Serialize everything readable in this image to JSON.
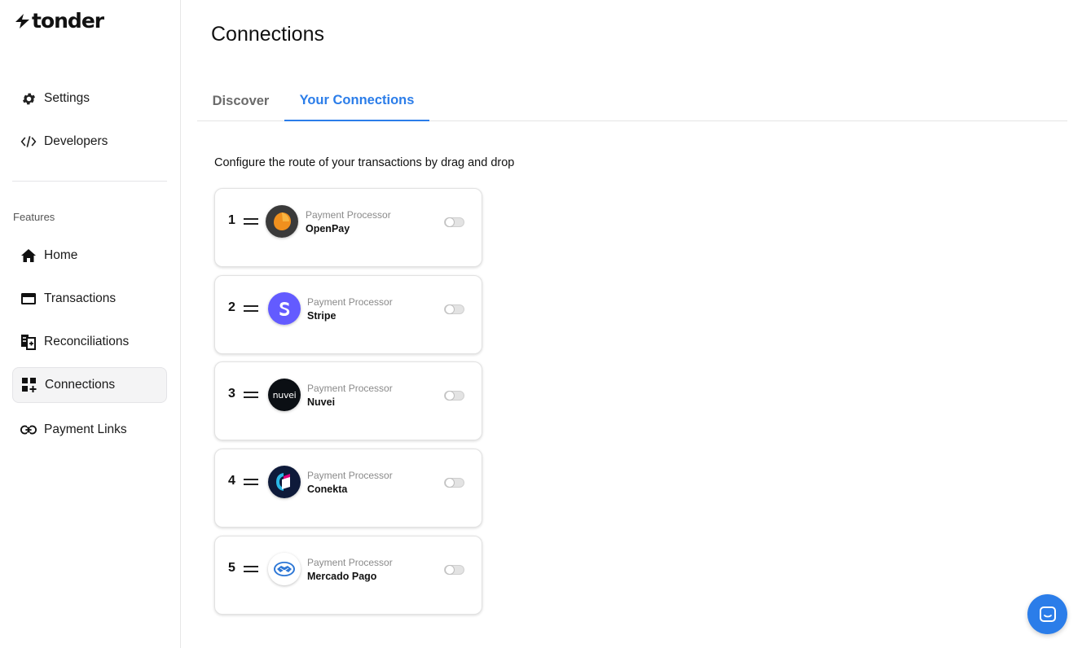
{
  "app": {
    "name": "tonder"
  },
  "sidebar": {
    "top_items": [
      {
        "label": "Settings",
        "icon": "gear-icon"
      },
      {
        "label": "Developers",
        "icon": "code-icon"
      }
    ],
    "section_label": "Features",
    "feature_items": [
      {
        "label": "Home",
        "icon": "home-icon"
      },
      {
        "label": "Transactions",
        "icon": "card-icon"
      },
      {
        "label": "Reconciliations",
        "icon": "reconcile-icon"
      },
      {
        "label": "Connections",
        "icon": "widgets-icon",
        "active": true
      },
      {
        "label": "Payment Links",
        "icon": "link-icon"
      }
    ]
  },
  "main": {
    "title": "Connections",
    "tabs": [
      {
        "label": "Discover",
        "active": false
      },
      {
        "label": "Your Connections",
        "active": true
      }
    ],
    "hint": "Configure the route of your transactions by drag and drop",
    "connections": [
      {
        "order": "1",
        "category": "Payment Processor",
        "name": "OpenPay",
        "logo": "openpay-logo",
        "enabled": false
      },
      {
        "order": "2",
        "category": "Payment Processor",
        "name": "Stripe",
        "logo": "stripe-logo",
        "enabled": false
      },
      {
        "order": "3",
        "category": "Payment Processor",
        "name": "Nuvei",
        "logo": "nuvei-logo",
        "logo_text": "nuvei",
        "enabled": false
      },
      {
        "order": "4",
        "category": "Payment Processor",
        "name": "Conekta",
        "logo": "conekta-logo",
        "enabled": false
      },
      {
        "order": "5",
        "category": "Payment Processor",
        "name": "Mercado Pago",
        "logo": "mercadopago-logo",
        "enabled": false
      }
    ]
  },
  "colors": {
    "accent": "#2b7de9",
    "sidebar_active_bg": "#f4f4f5",
    "stripe": "#635bff",
    "openpay": "#f0901e",
    "nuvei": "#0b0f14",
    "conekta": "#0e1a3a"
  }
}
